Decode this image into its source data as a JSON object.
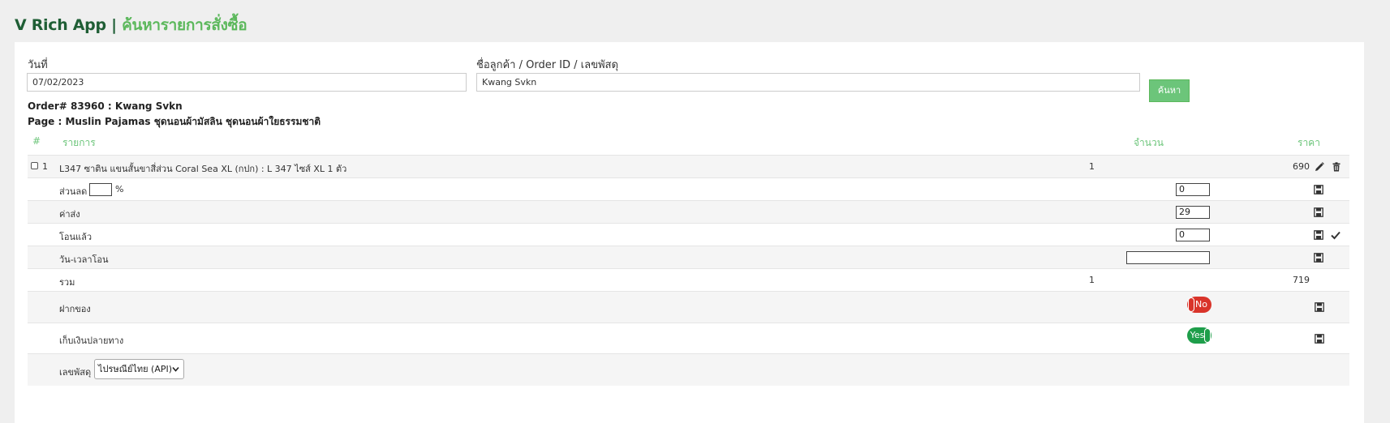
{
  "header": {
    "app_name": "V Rich App",
    "separator": "|",
    "page_title": "ค้นหารายการสั่งซื้อ"
  },
  "search": {
    "date_label": "วันที่",
    "date_value": "07/02/2023",
    "query_label": "ชื่อลูกค้า / Order ID / เลขพัสดุ",
    "query_value": "Kwang Svkn",
    "button_label": "ค้นหา"
  },
  "order": {
    "order_line": "Order# 83960 : Kwang Svkn",
    "page_line": "Page : Muslin Pajamas ชุดนอนผ้ามัสลิน ชุดนอนผ้าใยธรรมชาติ"
  },
  "table": {
    "headers": {
      "index": "#",
      "item": "รายการ",
      "qty": "จำนวน",
      "price": "ราคา"
    },
    "item": {
      "index": "1",
      "name": "L347 ซาติน แขนสั้นขาสี่ส่วน Coral Sea XL (กปก) : L 347 ไซส์ XL 1 ตัว",
      "qty": "1",
      "price": "690"
    },
    "discount": {
      "label": "ส่วนลด",
      "percent_value": "",
      "percent_sign": "%",
      "value": "0"
    },
    "shipping": {
      "label": "ค่าส่ง",
      "value": "29"
    },
    "transferred": {
      "label": "โอนแล้ว",
      "value": "0"
    },
    "transfer_datetime": {
      "label": "วัน-เวลาโอน",
      "value": ""
    },
    "total": {
      "label": "รวม",
      "qty": "1",
      "price": "719"
    },
    "deposit": {
      "label": "ฝากของ",
      "toggle": "No"
    },
    "cod": {
      "label": "เก็บเงินปลายทาง",
      "toggle": "Yes"
    },
    "tracking": {
      "label": "เลขพัสดุ",
      "carrier_selected": "ไปรษณีย์ไทย (API)"
    }
  },
  "colors": {
    "brand_dark": "#1f5e35",
    "brand_green": "#5cb85c",
    "toggle_no": "#d9342a",
    "toggle_yes": "#1e9e4a"
  },
  "icons": [
    "pencil-icon",
    "trash-icon",
    "save-icon",
    "check-icon",
    "chevron-down-icon"
  ]
}
